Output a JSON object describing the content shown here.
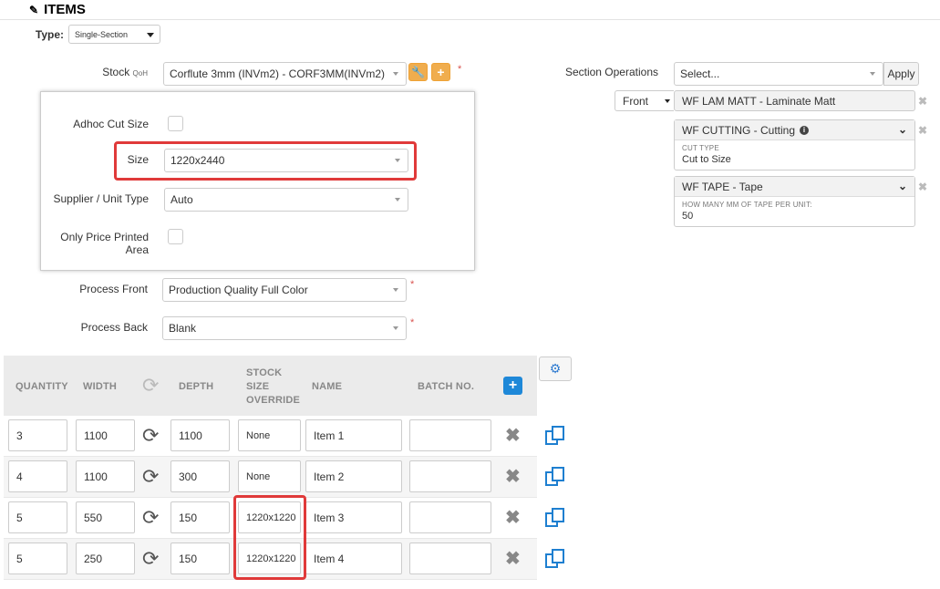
{
  "header": {
    "title": "ITEMS"
  },
  "type_field": {
    "label": "Type:",
    "value": "Single-Section"
  },
  "stock": {
    "label": "Stock",
    "qoh": "QoH",
    "value": "Corflute 3mm (INVm2) - CORF3MM(INVm2)"
  },
  "panel": {
    "adhoc_label": "Adhoc Cut Size",
    "size_label": "Size",
    "size_value": "1220x2440",
    "supplier_label": "Supplier / Unit Type",
    "supplier_value": "Auto",
    "printed_area_label": "Only Price Printed Area"
  },
  "process": {
    "front_label": "Process Front",
    "front_value": "Production Quality Full Color",
    "back_label": "Process Back",
    "back_value": "Blank"
  },
  "section_ops": {
    "label": "Section Operations",
    "select_placeholder": "Select...",
    "apply_label": "Apply",
    "side_value": "Front",
    "ops": [
      {
        "name": "WF LAM MATT - Laminate Matt"
      },
      {
        "name": "WF CUTTING - Cutting",
        "field_label": "CUT TYPE",
        "field_value": "Cut to Size"
      },
      {
        "name": "WF TAPE - Tape",
        "field_label": "HOW MANY MM OF TAPE PER UNIT:",
        "field_value": "50"
      }
    ]
  },
  "table": {
    "headers": {
      "quantity": "QUANTITY",
      "width": "WIDTH",
      "depth": "DEPTH",
      "stock1": "STOCK",
      "stock2": "SIZE",
      "stock3": "OVERRIDE",
      "name": "NAME",
      "batch": "BATCH NO."
    },
    "rows": [
      {
        "quantity": "3",
        "width": "1100",
        "depth": "1100",
        "override": "None",
        "name": "Item 1",
        "batch": ""
      },
      {
        "quantity": "4",
        "width": "1100",
        "depth": "300",
        "override": "None",
        "name": "Item 2",
        "batch": ""
      },
      {
        "quantity": "5",
        "width": "550",
        "depth": "150",
        "override": "1220x1220",
        "name": "Item 3",
        "batch": ""
      },
      {
        "quantity": "5",
        "width": "250",
        "depth": "150",
        "override": "1220x1220",
        "name": "Item 4",
        "batch": ""
      }
    ]
  },
  "colors": {
    "accent_orange": "#f0ad4e",
    "highlight_red": "#e03a3a",
    "primary_blue": "#1e88d8"
  }
}
